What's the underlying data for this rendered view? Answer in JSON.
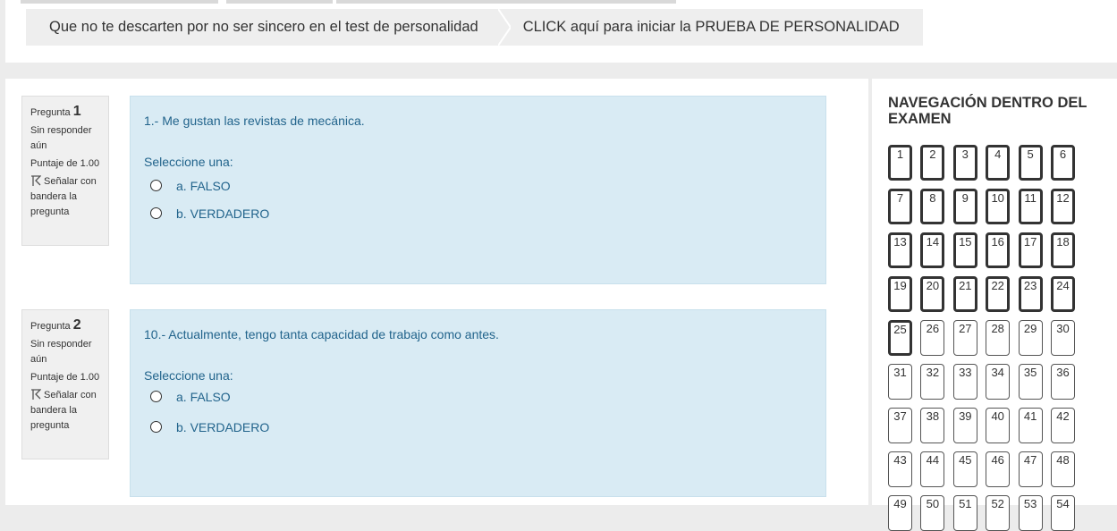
{
  "breadcrumb": {
    "items": [
      "Que no te descarten por no ser sincero en el test de personalidad",
      "CLICK aquí para iniciar la PRUEBA DE PERSONALIDAD"
    ]
  },
  "questions": [
    {
      "label_prefix": "Pregunta",
      "number": "1",
      "status": "Sin responder aún",
      "score": "Puntaje de 1.00",
      "flag_label": "Señalar con bandera la pregunta",
      "text": "1.- Me gustan las revistas de mecánica.",
      "prompt": "Seleccione una:",
      "options": [
        "a. FALSO",
        "b. VERDADERO"
      ]
    },
    {
      "label_prefix": "Pregunta",
      "number": "2",
      "status": "Sin responder aún",
      "score": "Puntaje de 1.00",
      "flag_label": "Señalar con bandera la pregunta",
      "text": "10.- Actualmente, tengo tanta capacidad de trabajo como antes.",
      "prompt": "Seleccione una:",
      "options": [
        "a. FALSO",
        "b. VERDADERO"
      ]
    }
  ],
  "navigation": {
    "title": "NAVEGACIÓN DENTRO DEL EXAMEN",
    "buttons": [
      "1",
      "2",
      "3",
      "4",
      "5",
      "6",
      "7",
      "8",
      "9",
      "10",
      "11",
      "12",
      "13",
      "14",
      "15",
      "16",
      "17",
      "18",
      "19",
      "20",
      "21",
      "22",
      "23",
      "24",
      "25",
      "26",
      "27",
      "28",
      "29",
      "30",
      "31",
      "32",
      "33",
      "34",
      "35",
      "36",
      "37",
      "38",
      "39",
      "40",
      "41",
      "42",
      "43",
      "44",
      "45",
      "46",
      "47",
      "48",
      "49",
      "50",
      "51",
      "52",
      "53",
      "54"
    ],
    "highlighted_count": 25
  },
  "colors": {
    "question_bg": "#d9ebf4",
    "question_text": "#22648c"
  }
}
